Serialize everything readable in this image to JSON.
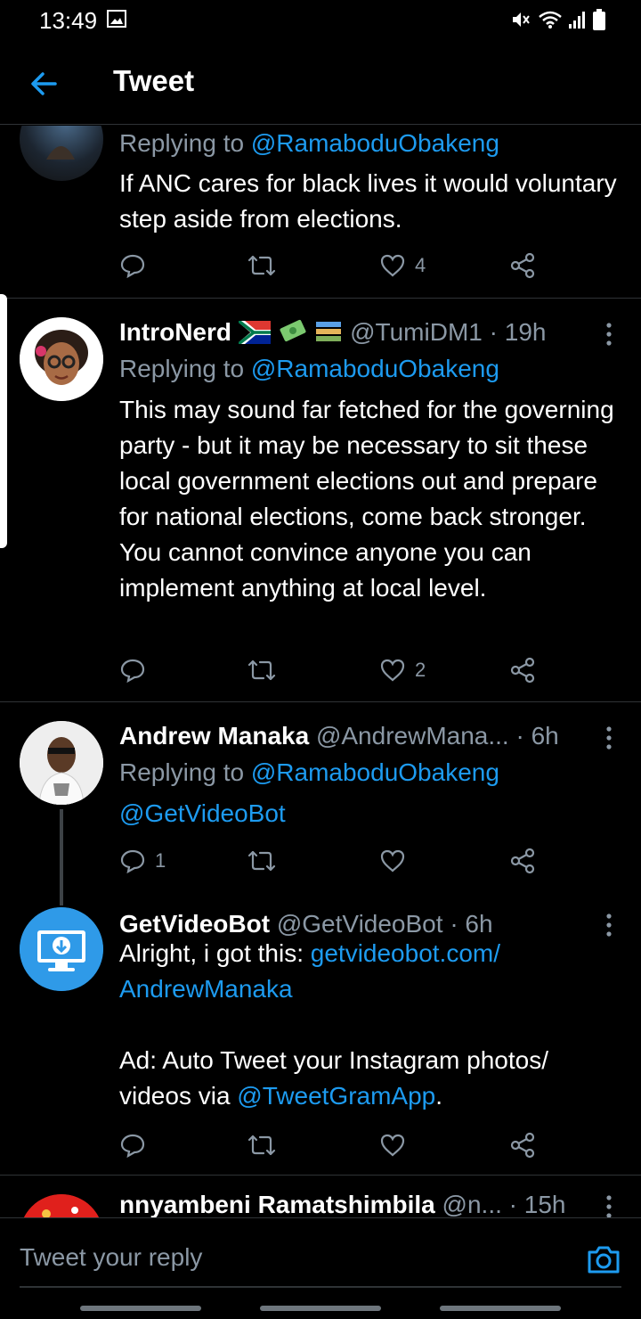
{
  "status": {
    "time": "13:49"
  },
  "header": {
    "title": "Tweet"
  },
  "colors": {
    "accent": "#1d9bf0",
    "muted": "#8b98a5",
    "divider": "#2f3336"
  },
  "tweets": [
    {
      "reply_prefix": "Replying to ",
      "reply_to": "@RamaboduObakeng",
      "body": "If ANC cares for black lives it would voluntary step aside from elections.",
      "likes": "4"
    },
    {
      "name": "IntroNerd",
      "handle": "@TumiDM1",
      "time": "· 19h",
      "reply_prefix": "Replying to ",
      "reply_to": "@RamaboduObakeng",
      "body": "This may sound far fetched for the governing party - but it may be necessary to sit these local government elections out and prepare for national elections, come back stronger. You cannot convince anyone you can implement anything at local level.",
      "likes": "2"
    },
    {
      "name": "Andrew Manaka",
      "handle": "@AndrewMana...",
      "time": "· 6h",
      "reply_prefix": "Replying to ",
      "reply_to": "@RamaboduObakeng",
      "mention": "@GetVideoBot",
      "replies": "1"
    },
    {
      "name": "GetVideoBot",
      "handle": "@GetVideoBot",
      "time": "· 6h",
      "body_prefix": "Alright, i got this: ",
      "link_line1": "getvideobot.com/",
      "link_line2": "AndrewManaka",
      "ad_prefix": "Ad: Auto Tweet your Instagram photos/ videos via ",
      "ad_mention": "@TweetGramApp",
      "ad_suffix": "."
    },
    {
      "name": "nnyambeni Ramatshimbila",
      "handle": "@n...",
      "time": "· 15h"
    }
  ],
  "reply_box": {
    "placeholder": "Tweet your reply"
  },
  "icons": [
    "back-arrow-icon",
    "reply-icon",
    "retweet-icon",
    "heart-icon",
    "share-icon",
    "more-icon",
    "camera-icon"
  ]
}
